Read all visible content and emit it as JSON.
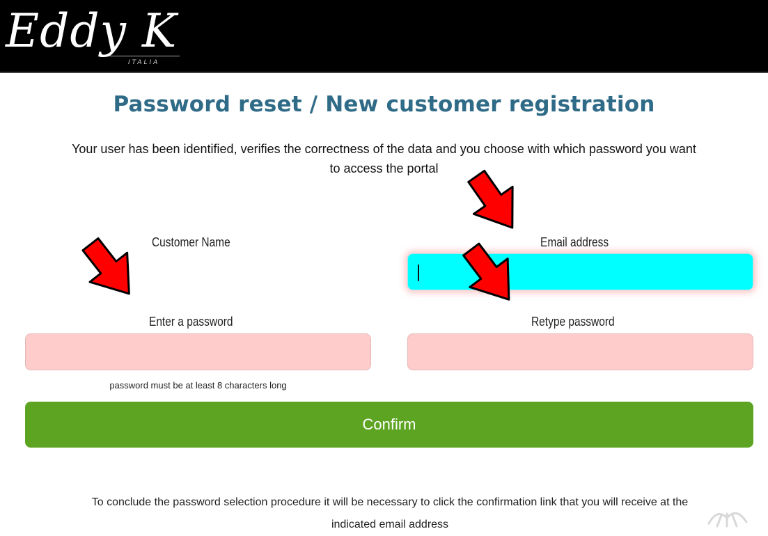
{
  "header": {
    "logo_text": "Eddy K",
    "logo_subtext": "ITALIA"
  },
  "page": {
    "title": "Password reset / New customer registration",
    "intro_line1": "Your user has been identified, verifies the correctness of the data and you choose with which password you want",
    "intro_line2": "to access the portal"
  },
  "form": {
    "customer_name_label": "Customer Name",
    "email_label": "Email address",
    "email_value": "",
    "password_label": "Enter a password",
    "password_value": "",
    "retype_label": "Retype password",
    "retype_value": "",
    "password_hint": "password must be at least 8 characters long",
    "confirm_label": "Confirm"
  },
  "footer": {
    "note_line1": "To conclude the password selection procedure it will be necessary to click the confirmation link that you will receive at the",
    "note_line2": "indicated email address"
  },
  "colors": {
    "title": "#2f6b87",
    "confirm_bg": "#5ea423",
    "field_invalid_bg": "#ffcccc",
    "field_focus_bg": "#00ffff",
    "annotation_arrow": "#ff0000"
  },
  "icons": {
    "annotation": "red-arrow-icon"
  }
}
